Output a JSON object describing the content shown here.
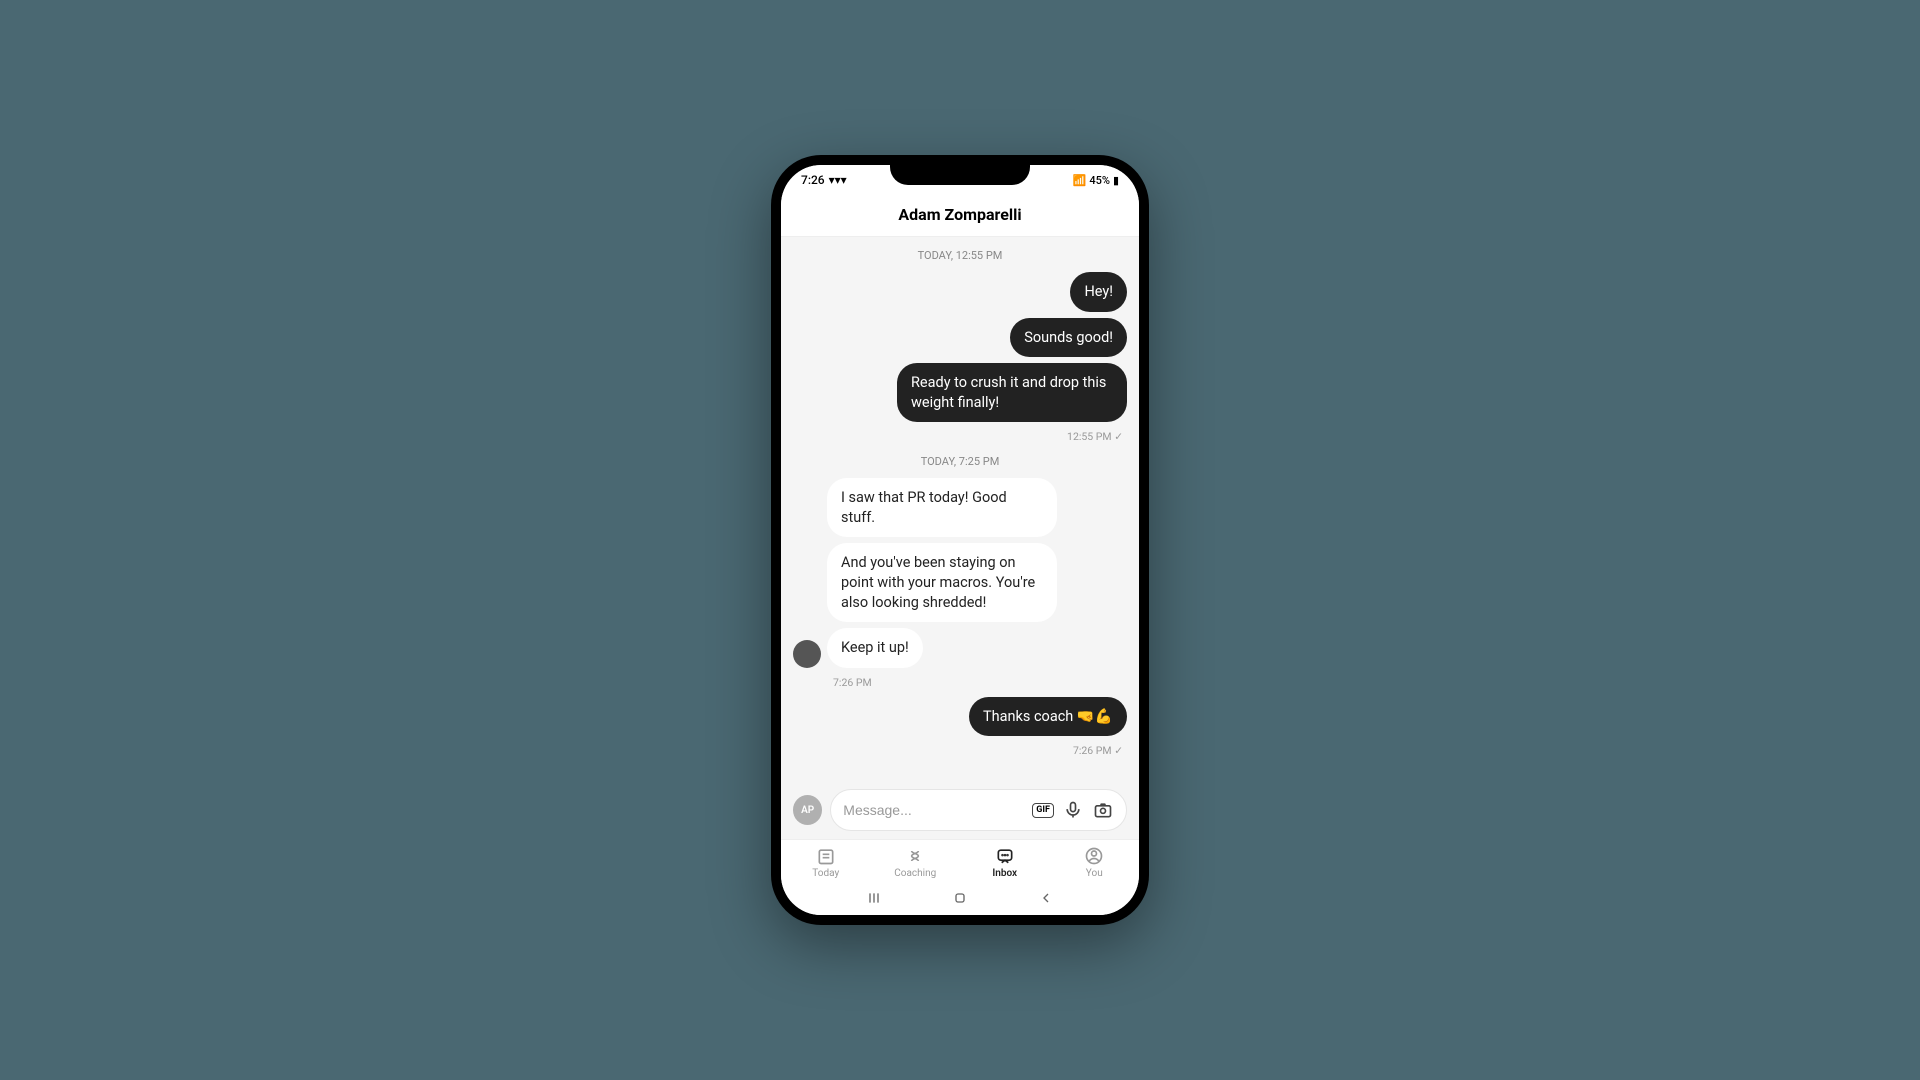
{
  "status": {
    "time": "7:26",
    "battery": "45%"
  },
  "header": {
    "title": "Adam Zomparelli"
  },
  "dividers": {
    "d1": "TODAY, 12:55 PM",
    "d2": "TODAY, 7:25 PM"
  },
  "messages": {
    "m1": "Hey!",
    "m2": "Sounds good!",
    "m3": "Ready to crush it and drop this weight finally!",
    "m3_time": "12:55 PM ✓",
    "m4": "I saw that PR today! Good stuff.",
    "m5": "And you've been staying on point with your macros. You're also looking shredded!",
    "m6": "Keep it up!",
    "m6_time": "7:26 PM",
    "m7": "Thanks coach 🤜💪",
    "m7_time": "7:26 PM ✓"
  },
  "composer": {
    "avatar_initials": "AP",
    "placeholder": "Message...",
    "gif": "GIF"
  },
  "nav": {
    "today": "Today",
    "coaching": "Coaching",
    "inbox": "Inbox",
    "you": "You"
  }
}
